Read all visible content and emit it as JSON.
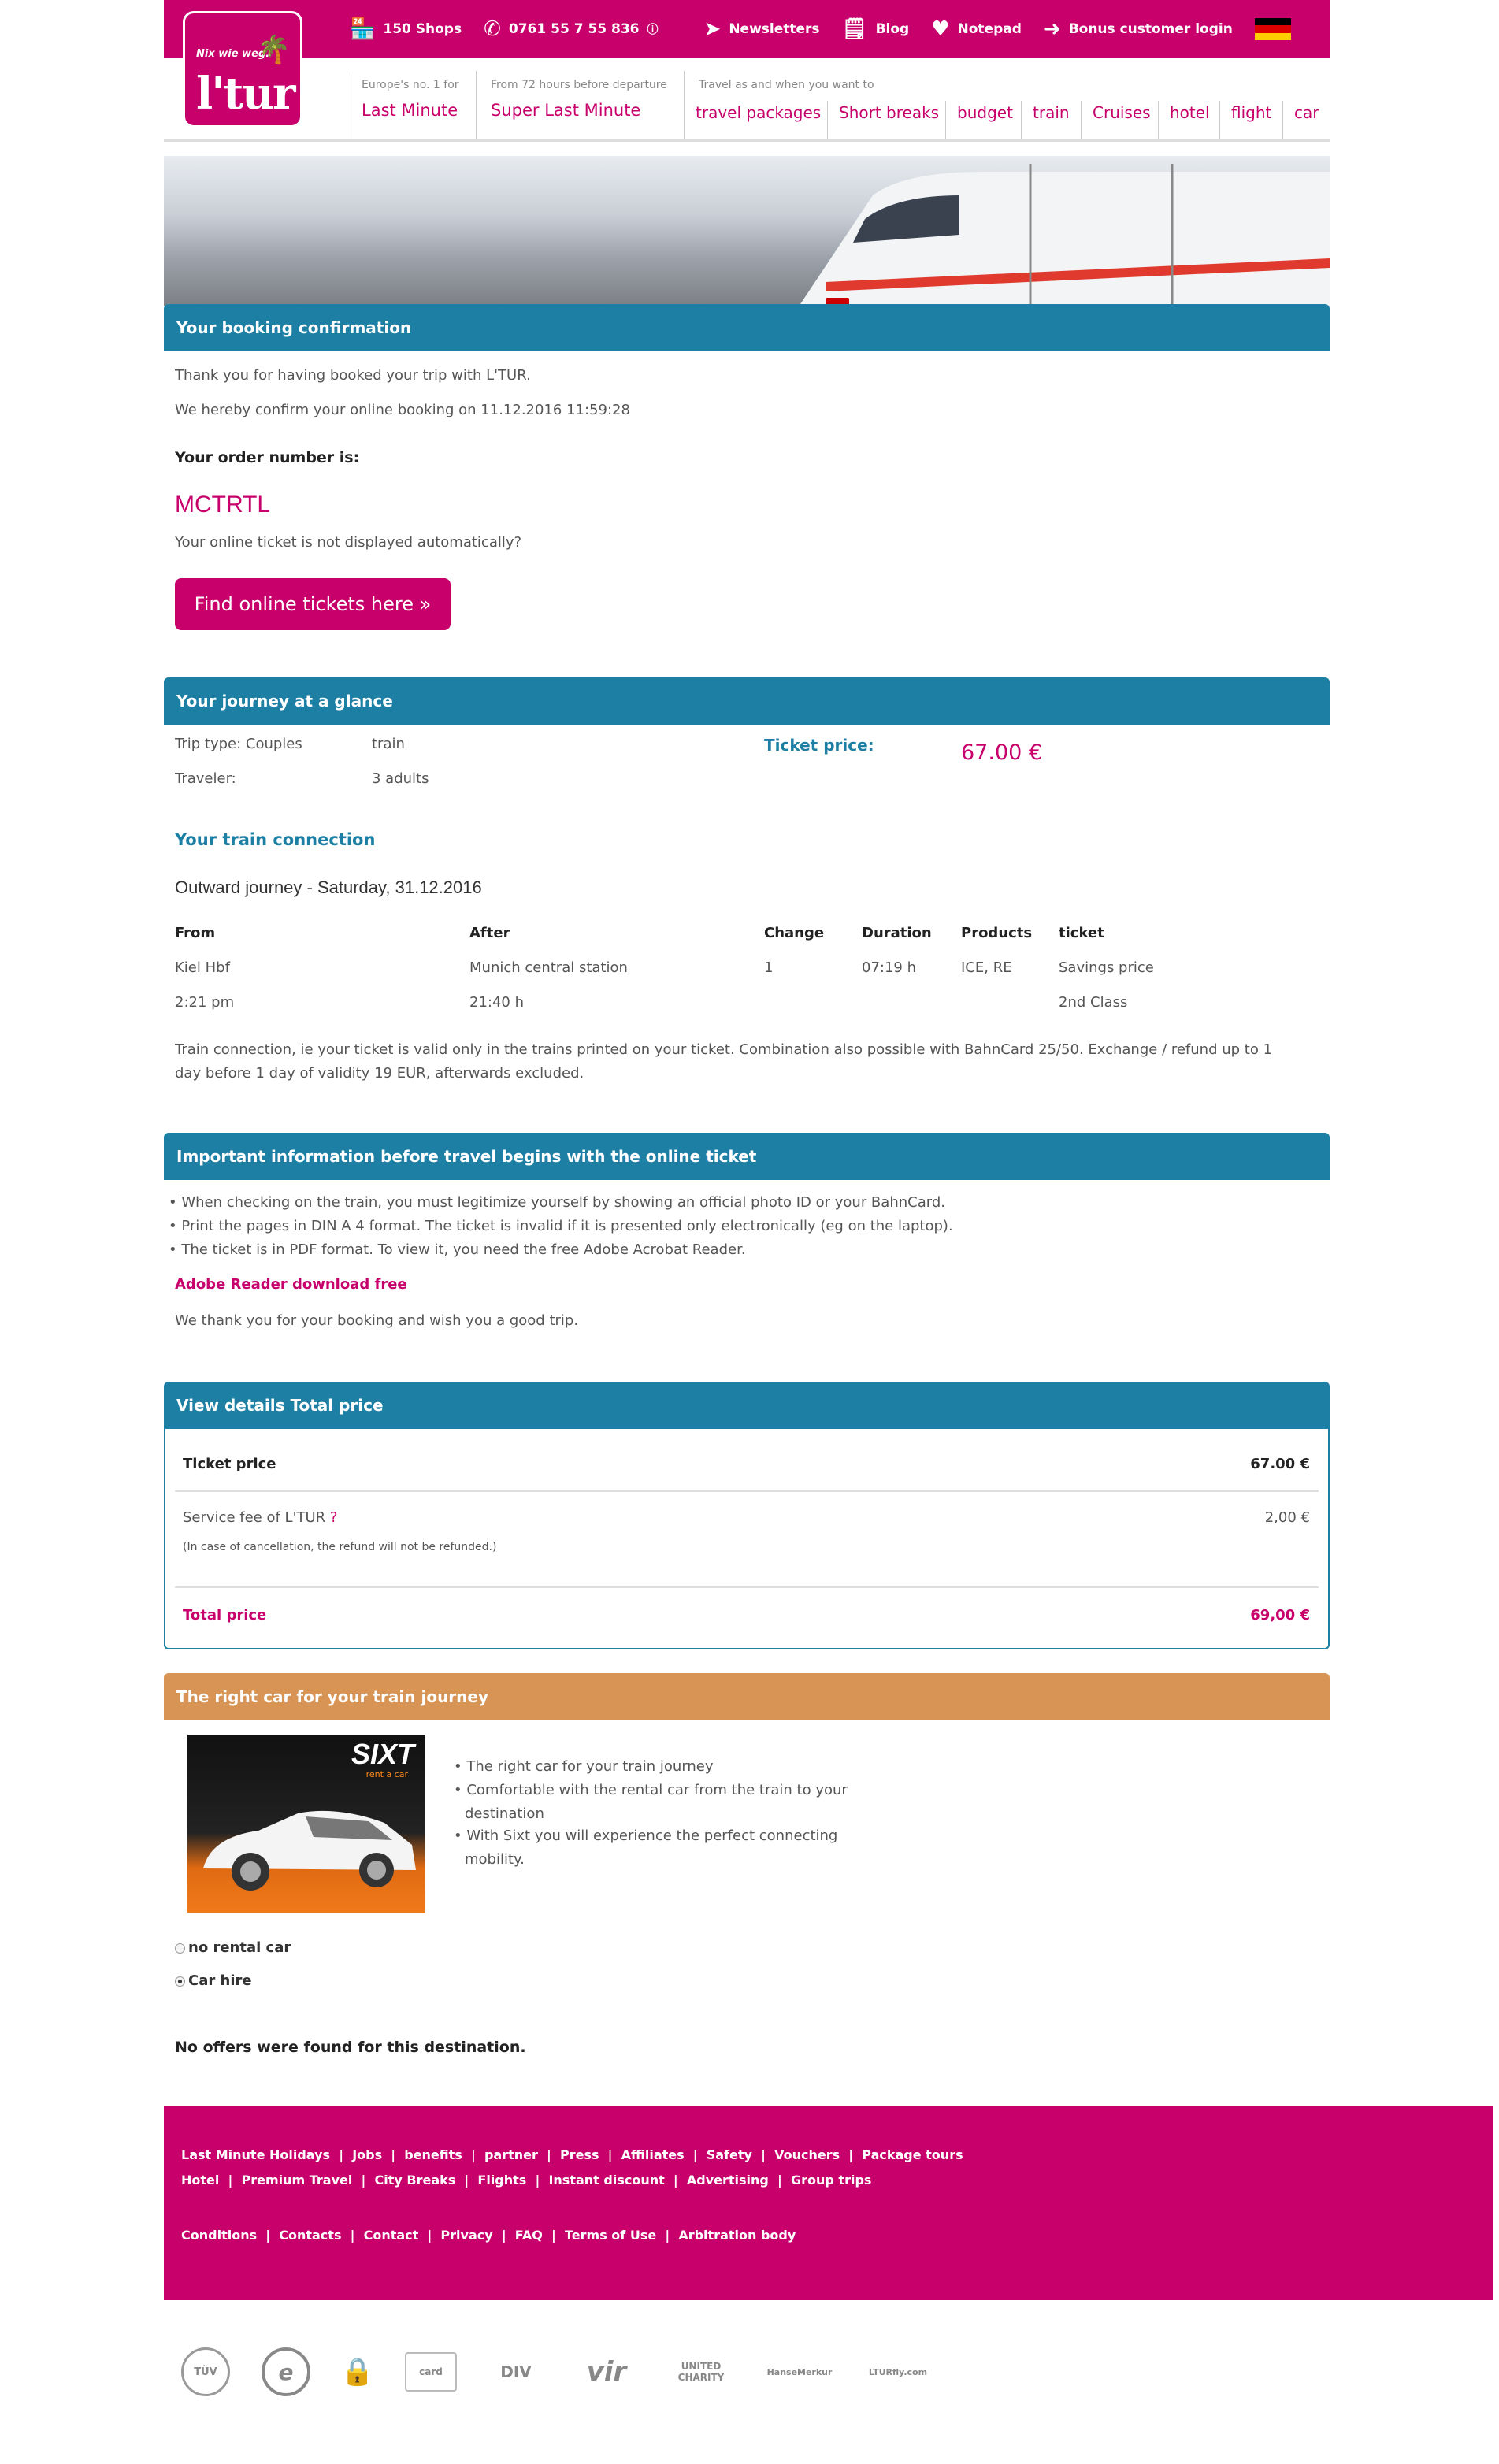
{
  "brand": {
    "name": "l'tur",
    "slogan": "Nix wie weg."
  },
  "toplinks": [
    {
      "label": "150 Shops",
      "icon": "shop-icon"
    },
    {
      "label": "0761 55 7 55 836",
      "icon": "phone-icon",
      "suffix": "ⓘ"
    },
    {
      "label": "Newsletters",
      "icon": "send-icon"
    },
    {
      "label": "Blog",
      "icon": "notepad-icon"
    },
    {
      "label": "Notepad",
      "icon": "heart-icon"
    },
    {
      "label": "Bonus customer login",
      "icon": "arrow-circle-icon"
    }
  ],
  "nav": {
    "last_minute": {
      "sub": "Europe's no. 1 for",
      "main": "Last Minute"
    },
    "super_last_minute": {
      "sub": "From 72 hours before departure",
      "main": "Super Last Minute"
    },
    "travel": {
      "sub": "Travel as and when you want to"
    },
    "items": [
      "travel packages",
      "Short breaks",
      "budget",
      "train",
      "Cruises",
      "hotel",
      "flight",
      "car"
    ]
  },
  "confirmation": {
    "title": "Your booking confirmation",
    "thanks": "Thank you for having booked your trip with L'TUR.",
    "confirm": "We hereby confirm your online booking on 11.12.2016 11:59:28",
    "order_label": "Your order number is:",
    "order_number": "MCTRTL",
    "ticket_note": "Your online ticket is not displayed automatically?",
    "button": "Find online tickets here »"
  },
  "journey": {
    "title": "Your journey at a glance",
    "trip_type_label": "Trip type: Couples",
    "trip_type_value": "train",
    "traveler_label": "Traveler:",
    "traveler_value": "3 adults",
    "ticket_price_label": "Ticket price:",
    "ticket_price": "67.00 €",
    "connection_title": "Your train connection",
    "outward": "Outward journey - Saturday, 31.12.2016",
    "headers": {
      "from": "From",
      "after": "After",
      "change": "Change",
      "duration": "Duration",
      "products": "Products",
      "ticket": "ticket"
    },
    "row1": {
      "from": "Kiel Hbf",
      "after": "Munich central station",
      "change": "1",
      "duration": "07:19 h",
      "products": "ICE, RE",
      "ticket": "Savings price"
    },
    "row2": {
      "from": "2:21 pm",
      "after": "21:40 h",
      "ticket": "2nd Class"
    },
    "note1": "Train connection, ie your ticket is valid only in the trains printed on your ticket. Combination also possible with BahnCard 25/50. Exchange / refund up to 1",
    "note2": "day before 1 day of validity 19 EUR, afterwards excluded."
  },
  "important": {
    "title": "Important information before travel begins with the online ticket",
    "bullets": [
      "When checking on the train, you must legitimize yourself by showing an official photo ID or your BahnCard.",
      "Print the pages in DIN A 4 format. The ticket is invalid if it is presented only electronically (eg on the laptop).",
      "The ticket is in PDF format. To view it, you need the free Adobe Acrobat Reader."
    ],
    "adobe_link": "Adobe Reader download free",
    "farewell": "We thank you for your booking and wish you a good trip."
  },
  "total": {
    "title": "View details Total price",
    "ticket_price_label": "Ticket price",
    "ticket_price": "67.00 €",
    "fee_label": "Service fee of L'TUR",
    "fee_q": "?",
    "fee": "2,00 €",
    "fee_note": "(In case of cancellation, the refund will not be refunded.)",
    "total_label": "Total price",
    "total": "69,00 €"
  },
  "car": {
    "title": "The right car for your train journey",
    "sixt_logo": "SIXT",
    "sixt_sub": "rent a car",
    "bullets": [
      "The right car for your train journey",
      "Comfortable with the rental car from the train to your",
      "destination",
      "With Sixt you will experience the perfect connecting",
      "mobility."
    ],
    "option_none": "no rental car",
    "option_hire": "Car hire",
    "no_offers": "No offers were found for this destination."
  },
  "footer": {
    "row1": [
      "Last Minute Holidays",
      "Jobs",
      "benefits",
      "partner",
      "Press",
      "Affiliates",
      "Safety",
      "Vouchers",
      "Package tours"
    ],
    "row2": [
      "Hotel",
      "Premium Travel",
      "City Breaks",
      "Flights",
      "Instant discount",
      "Advertising",
      "Group trips"
    ],
    "row3": [
      "Conditions",
      "Contacts",
      "Contact",
      "Privacy",
      "FAQ",
      "Terms of Use",
      "Arbitration body"
    ]
  },
  "seals": [
    "TÜV",
    "e",
    "🔒",
    "card",
    "DIV",
    "vir",
    "UNITED CHARITY",
    "HanseMerkur",
    "LTURfly.com"
  ],
  "colors": {
    "brand": "#c8006b",
    "section": "#1c7fa3",
    "car_section": "#d89454"
  }
}
